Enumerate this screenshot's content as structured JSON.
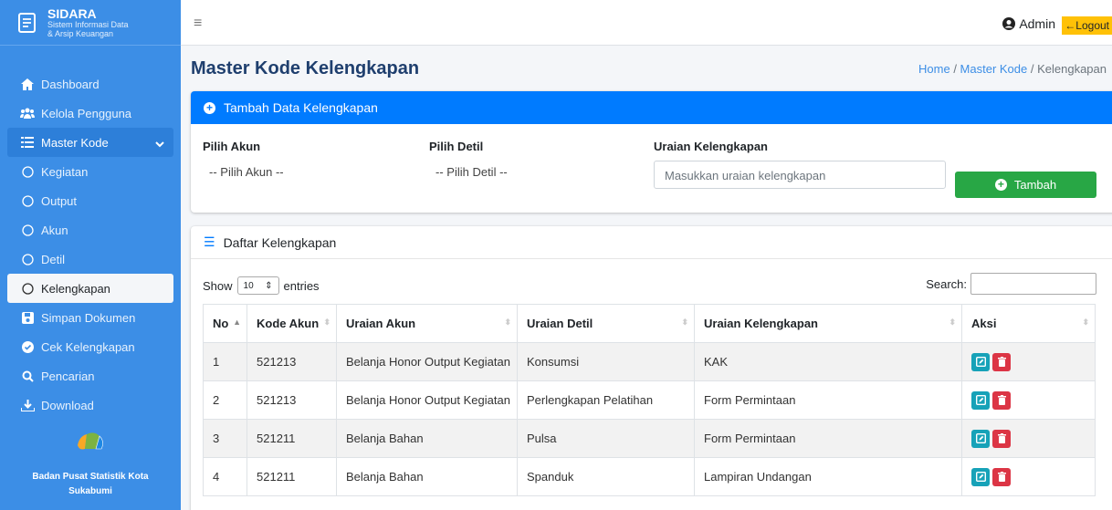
{
  "brand": {
    "title": "SIDARA",
    "sub1": "Sistem Informasi Data",
    "sub2": "& Arsip Keuangan"
  },
  "nav": [
    {
      "label": "Dashboard",
      "icon": "home-icon"
    },
    {
      "label": "Kelola Pengguna",
      "icon": "users-icon"
    },
    {
      "label": "Master Kode",
      "icon": "list-icon"
    },
    {
      "label": "Kegiatan",
      "icon": "circle-icon"
    },
    {
      "label": "Output",
      "icon": "circle-icon"
    },
    {
      "label": "Akun",
      "icon": "circle-icon"
    },
    {
      "label": "Detil",
      "icon": "circle-icon"
    },
    {
      "label": "Kelengkapan",
      "icon": "circle-icon"
    },
    {
      "label": "Simpan Dokumen",
      "icon": "save-icon"
    },
    {
      "label": "Cek Kelengkapan",
      "icon": "check-circle-icon"
    },
    {
      "label": "Pencarian",
      "icon": "search-icon"
    },
    {
      "label": "Download",
      "icon": "download-icon"
    }
  ],
  "footer": {
    "org1": "Badan Pusat Statistik Kota",
    "org2": "Sukabumi"
  },
  "topbar": {
    "user": "Admin",
    "logout": "Logout"
  },
  "page": {
    "title": "Master Kode Kelengkapan",
    "breadcrumb": [
      "Home",
      "Master Kode",
      "Kelengkapan"
    ]
  },
  "form": {
    "header": "Tambah Data Kelengkapan",
    "akun_label": "Pilih Akun",
    "akun_value": "-- Pilih Akun --",
    "detil_label": "Pilih Detil",
    "detil_value": "-- Pilih Detil --",
    "uraian_label": "Uraian Kelengkapan",
    "uraian_placeholder": "Masukkan uraian kelengkapan",
    "add_label": "Tambah"
  },
  "list": {
    "header": "Daftar Kelengkapan",
    "show": "Show",
    "entries_value": "10",
    "entries": "entries",
    "search": "Search:"
  },
  "table": {
    "columns": [
      "No",
      "Kode Akun",
      "Uraian Akun",
      "Uraian Detil",
      "Uraian Kelengkapan",
      "Aksi"
    ],
    "rows": [
      [
        "1",
        "521213",
        "Belanja Honor Output Kegiatan",
        "Konsumsi",
        "KAK"
      ],
      [
        "2",
        "521213",
        "Belanja Honor Output Kegiatan",
        "Perlengkapan Pelatihan",
        "Form Permintaan"
      ],
      [
        "3",
        "521211",
        "Belanja Bahan",
        "Pulsa",
        "Form Permintaan"
      ],
      [
        "4",
        "521211",
        "Belanja Bahan",
        "Spanduk",
        "Lampiran Undangan"
      ]
    ]
  },
  "colors": {
    "sidebar": "#3c8ee6",
    "primary": "#007bff",
    "success": "#28a745",
    "edit": "#17a2b8",
    "delete": "#dc3545",
    "logout": "#ffc107"
  }
}
